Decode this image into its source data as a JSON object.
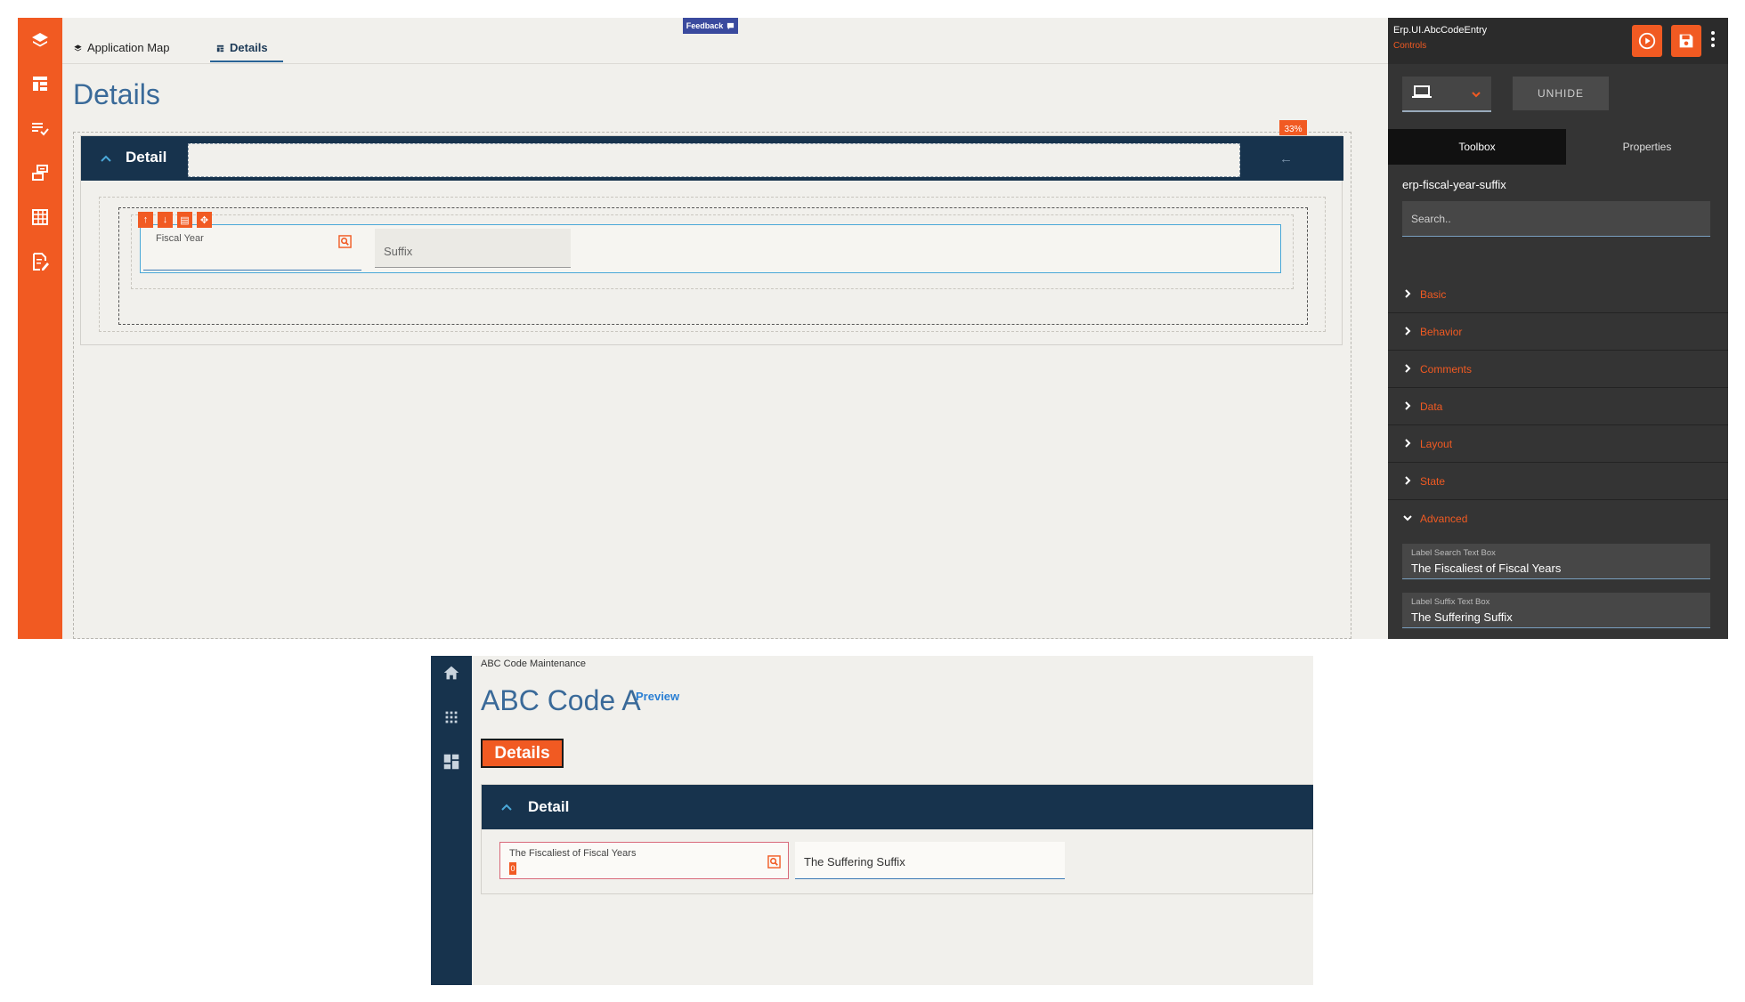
{
  "designer": {
    "rail_icons": [
      "layers-icon",
      "layout-icon",
      "checklist-icon",
      "forms-icon",
      "grid-icon",
      "edit-doc-icon"
    ],
    "tabs": [
      {
        "label": "Application Map",
        "icon": "layers-icon"
      },
      {
        "label": "Details",
        "icon": "layout-icon",
        "active": true
      }
    ],
    "feedback_label": "Feedback",
    "page_title": "Details",
    "detail_title": "Detail",
    "back_arrow": "←",
    "percent_badge": "33%",
    "control_toolbar": [
      "↑",
      "↓",
      "▤",
      "✥"
    ],
    "fiscal_year_label": "Fiscal Year",
    "suffix_label": "Suffix"
  },
  "props": {
    "title": "Erp.UI.AbcCodeEntry",
    "subtitle": "Controls",
    "unhide_label": "UNHIDE",
    "tabs": [
      "Toolbox",
      "Properties"
    ],
    "component_name": "erp-fiscal-year-suffix",
    "search_placeholder": "Search..",
    "sections": [
      {
        "label": "Basic",
        "expanded": false
      },
      {
        "label": "Behavior",
        "expanded": false
      },
      {
        "label": "Comments",
        "expanded": false
      },
      {
        "label": "Data",
        "expanded": false
      },
      {
        "label": "Layout",
        "expanded": false
      },
      {
        "label": "State",
        "expanded": false
      },
      {
        "label": "Advanced",
        "expanded": true
      }
    ],
    "fields": [
      {
        "key": "Label Search Text Box",
        "value": "The Fiscaliest of Fiscal Years"
      },
      {
        "key": "Label Suffix Text Box",
        "value": "The Suffering Suffix"
      }
    ]
  },
  "preview": {
    "rail_icons": [
      "home-icon",
      "apps-icon",
      "dashboard-icon"
    ],
    "breadcrumb": "ABC Code Maintenance",
    "title": "ABC Code A",
    "preview_label": "Preview",
    "details_button": "Details",
    "detail_title": "Detail",
    "fiscal_year_label": "The Fiscaliest of Fiscal Years",
    "fiscal_year_caret": "0",
    "suffix_value": "The Suffering Suffix"
  },
  "colors": {
    "accent": "#f15a22",
    "navy": "#17334d",
    "title_blue": "#3a6a99",
    "panel_dark": "#343434"
  }
}
